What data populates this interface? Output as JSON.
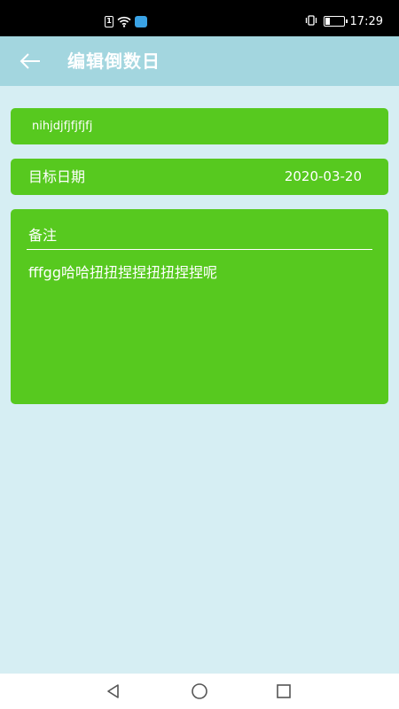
{
  "status_bar": {
    "time": "17:29",
    "sim_label": "1",
    "icons": [
      "sim-icon",
      "wifi-icon",
      "app-notification-icon",
      "vibrate-icon",
      "battery-icon"
    ],
    "battery_level": 0.25
  },
  "app_bar": {
    "back_icon": "arrow-left-icon",
    "title": "编辑倒数日"
  },
  "form": {
    "name_value": "nihjdjfjfjfjfj",
    "date_label": "目标日期",
    "date_value": "2020-03-20",
    "note_label": "备注",
    "note_value": "fffgg哈哈扭扭捏捏扭扭捏捏呢"
  },
  "colors": {
    "status_bar": "#000000",
    "app_bar": "#a3d6df",
    "background": "#d6eef3",
    "card": "#57c91f",
    "text": "#ffffff"
  },
  "nav_bar": {
    "icons": [
      "back-triangle-icon",
      "home-circle-icon",
      "recents-square-icon"
    ]
  }
}
